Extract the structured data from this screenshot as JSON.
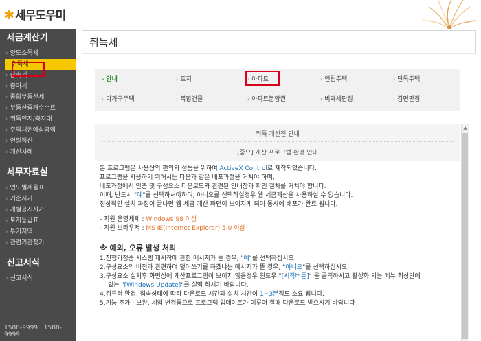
{
  "header": {
    "logo_mark": "✱",
    "logo_text": "세무도우미"
  },
  "sidebar": {
    "section1": {
      "title": "세금계산기",
      "items": [
        "양도소득세",
        "취득세",
        "상속세",
        "증여세",
        "종합부동산세",
        "부동산중개수수료",
        "취득인지/증지대",
        "주택채권예상금액",
        "연말정산",
        "계산사례"
      ]
    },
    "section2": {
      "title": "세무자료실",
      "items": [
        "연도별세율표",
        "기준시가",
        "개별공시지가",
        "토지등급표",
        "투기지역",
        "관련기관찾기"
      ]
    },
    "section3": {
      "title": "신고서식",
      "items": [
        "신고서식"
      ]
    },
    "phone": "1588-9999 | 1588-9999"
  },
  "page_title": "취득세",
  "tabs": [
    "안내",
    "토지",
    "아파트",
    "연립주택",
    "단독주택",
    "다가구주택",
    "복합건물",
    "아파트분양권",
    "비과세판정",
    "감면판정"
  ],
  "calc": {
    "title": "취득 계산전 안내",
    "subtitle": "[중요] 계산 프로그램 환경 안내"
  },
  "content": {
    "l1a": "본 프로그램은 사용상의 편의와 성능을 위하여 ",
    "l1b": "ActiveX Control",
    "l1c": "로 제작되었습니다.",
    "l2": "프로그램을 사용하기 위해서는 다음과 같은 배포과정을 거쳐야 하며,",
    "l3a": "배포과정에서 ",
    "l3b": "인증 및 구성요소 다운로드와 관련된 안내창과 확인 절차를 거쳐야 합니다.",
    "l4a": "이때, 반드시 \"",
    "l4b": "예",
    "l4c": "\"를 선택하셔야하며, 아니오를 선택하실경우 웹 세금계산을 사용하실 수 없습니다.",
    "l5": "정상적인 설치 과정이 끝나면 웹 세금 계산 화면이 보여지게 되며 동시에 배포가 완료 됩니다.",
    "l6a": "- 지원 운영체제 : ",
    "l6b": "Windows 98 이상",
    "l7a": "- 지원 브라우저 : ",
    "l7b": "MS IE(Internet Explorer) 5.0 이상",
    "h": "※ 예외, 오류 발생 처리",
    "e1a": "1.진행과정중 시스템 재시작에 관한 메시지가 뜰 경우, \"",
    "e1b": "예",
    "e1c": "\"를 선택하십시오.",
    "e2a": "2.구성요소의 버전과 관련하여 덮어쓰기를 하겠냐는 메시지가 뜰 경우, \"",
    "e2b": "아니오",
    "e2c": "\"를 선택하십시오.",
    "e3a": "3.구성요소 설치후 화면상에 계산프로그램이 보이지 않을경우 윈도우 \"",
    "e3b": "[시작버튼]",
    "e3c": "\" 을 클릭하시고 활성화 되는 메뉴 최상단에",
    "e3d": "있는 \"",
    "e3e": "[Windows Update]",
    "e3f": "\"를 실행 하시기 바랍니다.",
    "e4a": "4.컴퓨터 환경, 접속상태에 따라 다운로드 시간과 설치 시간이 ",
    "e4b": "1~3분",
    "e4c": "정도 소요 됩니다.",
    "e5": "5.기능 추가 · 보완, 세법 변경등으로 프로그램 업데이트가 이루어 질때 다운로드 받으시기 바랍니다"
  },
  "colors": {
    "sidebar_bg": "#4a4a4a",
    "active_item": "#f6c800",
    "highlight_box": "#d6001c",
    "link_blue": "#1a6fb8",
    "accent_orange": "#e0702a",
    "tab_selected": "#2a8a2a"
  }
}
